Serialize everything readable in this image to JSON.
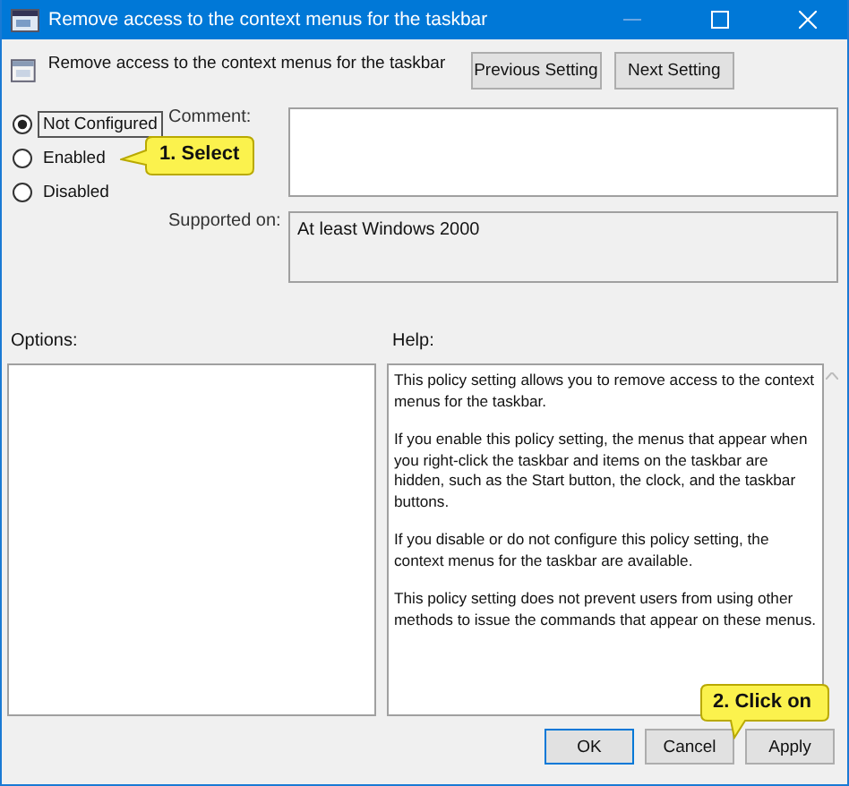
{
  "window": {
    "title": "Remove access to the context menus for the taskbar"
  },
  "header": {
    "policy_name": "Remove access to the context menus for the taskbar",
    "buttons": [
      {
        "label": "Previous Setting"
      },
      {
        "label": "Next Setting"
      }
    ]
  },
  "options": [
    {
      "label": "Not Configured",
      "selected": true
    },
    {
      "label": "Enabled",
      "selected": false
    },
    {
      "label": "Disabled",
      "selected": false
    }
  ],
  "comment": {
    "label": "Comment:"
  },
  "supported_on": {
    "label": "Supported on:",
    "value": "At least Windows 2000"
  },
  "options_label": "Options:",
  "help_label": "Help:",
  "help_paragraphs": [
    "This policy setting allows you to remove access to the context menus for the taskbar.",
    "If you enable this policy setting, the menus that appear when you right-click the taskbar and items on the taskbar are hidden, such as the Start button, the clock, and the taskbar buttons.",
    "If you disable or do not configure this policy setting, the context menus for the taskbar are available.",
    "This policy setting does not prevent users from using other methods to issue the commands that appear on these menus."
  ],
  "footer_buttons": [
    {
      "label": "OK",
      "default": true
    },
    {
      "label": "Cancel",
      "default": false
    },
    {
      "label": "Apply",
      "default": false
    }
  ],
  "callouts": [
    {
      "text": "1. Select"
    },
    {
      "text": "2. Click on"
    }
  ]
}
